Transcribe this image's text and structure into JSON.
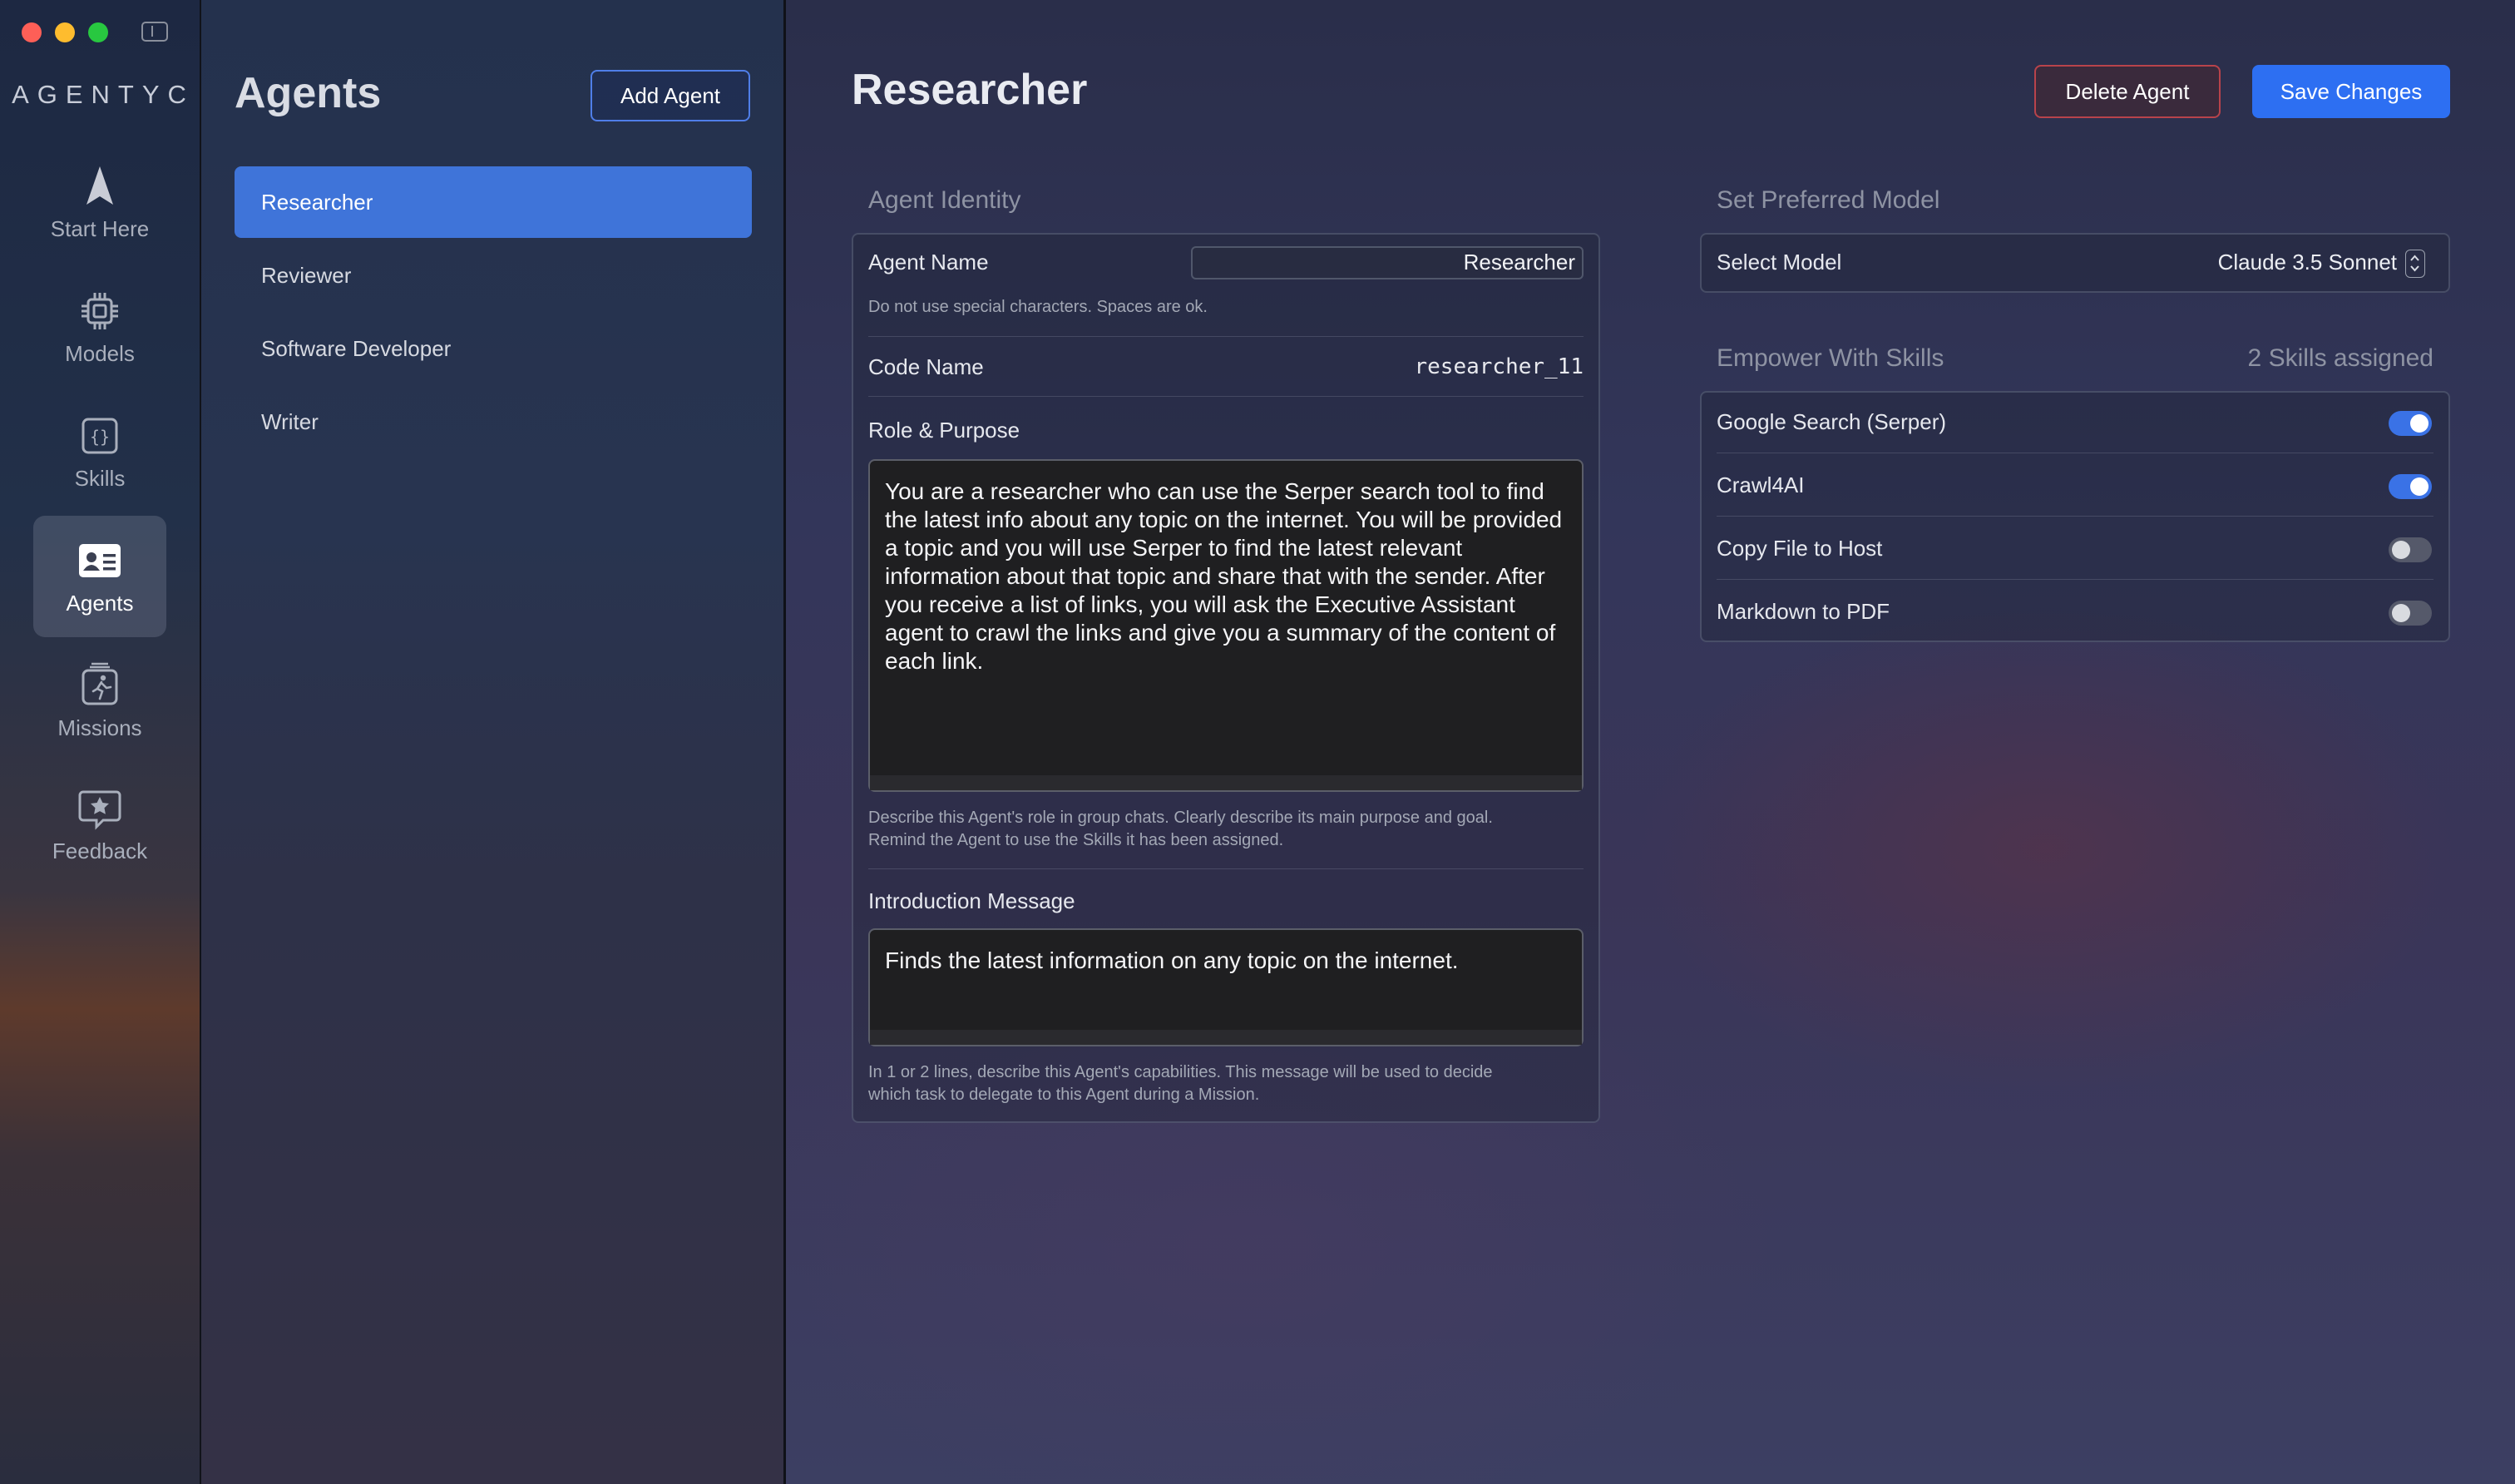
{
  "app": {
    "logo": "AGENTYC"
  },
  "nav": {
    "items": [
      {
        "label": "Start Here",
        "icon": "navigation-arrow-icon"
      },
      {
        "label": "Models",
        "icon": "cpu-chip-icon"
      },
      {
        "label": "Skills",
        "icon": "code-braces-icon"
      },
      {
        "label": "Agents",
        "icon": "id-card-icon",
        "active": true
      },
      {
        "label": "Missions",
        "icon": "running-person-icon"
      },
      {
        "label": "Feedback",
        "icon": "star-bubble-icon"
      }
    ]
  },
  "agents_list": {
    "title": "Agents",
    "add_label": "Add Agent",
    "items": [
      "Researcher",
      "Reviewer",
      "Software Developer",
      "Writer"
    ],
    "selected": "Researcher"
  },
  "main": {
    "title": "Researcher",
    "delete_label": "Delete Agent",
    "save_label": "Save Changes",
    "identity": {
      "section_label": "Agent Identity",
      "agent_name_label": "Agent Name",
      "agent_name_value": "Researcher",
      "agent_name_hint": "Do not use special characters. Spaces are ok.",
      "code_name_label": "Code Name",
      "code_name_value": "researcher_11",
      "role_label": "Role & Purpose",
      "role_value": "You are a researcher who can use the Serper search tool to find the latest info about any topic on the internet. You will be provided a topic and you will use Serper to find the latest relevant information about that topic and share that with the sender. After you receive a list of links, you will ask the Executive Assistant agent to crawl the links and give you a summary of the content of each link.",
      "role_hint_1": "Describe this Agent's role in group chats. Clearly describe its main purpose and goal.",
      "role_hint_2": "Remind the Agent to use the Skills it has been assigned.",
      "intro_label": "Introduction Message",
      "intro_value": "Finds the latest information on any topic on the internet.",
      "intro_hint_1": "In 1 or 2 lines, describe this Agent's capabilities. This message will be used to decide",
      "intro_hint_2": "which task to delegate to this Agent during a Mission."
    },
    "model": {
      "section_label": "Set Preferred Model",
      "select_label": "Select Model",
      "selected_model": "Claude 3.5 Sonnet"
    },
    "skills": {
      "section_label": "Empower With Skills",
      "count_label": "2 Skills assigned",
      "items": [
        {
          "label": "Google Search (Serper)",
          "enabled": true
        },
        {
          "label": "Crawl4AI",
          "enabled": true
        },
        {
          "label": "Copy File to Host",
          "enabled": false
        },
        {
          "label": "Markdown to PDF",
          "enabled": false
        }
      ]
    }
  },
  "colors": {
    "accent": "#3f74d9",
    "save_button": "#2d6ff2",
    "delete_border": "#b8434b"
  }
}
